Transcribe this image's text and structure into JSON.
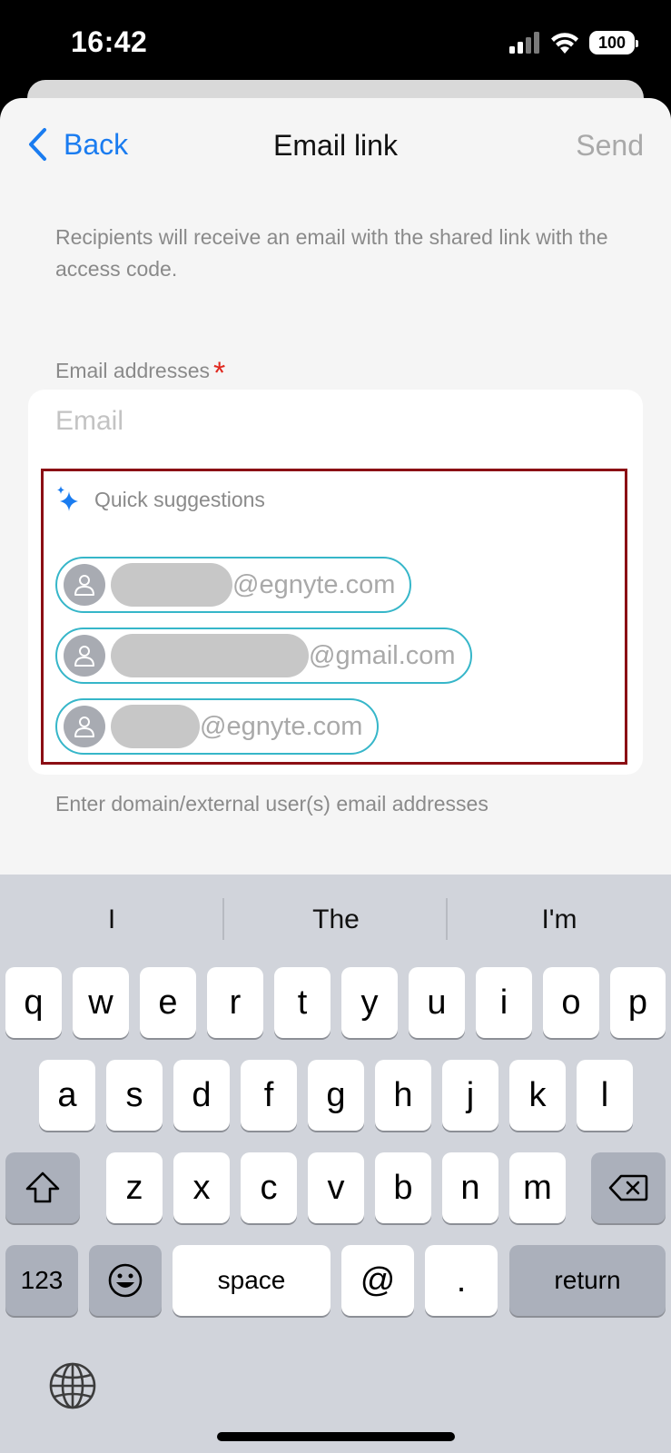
{
  "status_bar": {
    "time": "16:42",
    "battery": "100"
  },
  "nav": {
    "back_label": "Back",
    "title": "Email link",
    "send_label": "Send"
  },
  "description": "Recipients will receive an email with the shared link with the access code.",
  "email_field": {
    "label": "Email addresses",
    "required_mark": "*",
    "placeholder": "Email",
    "value": ""
  },
  "suggestions": {
    "title": "Quick suggestions",
    "items": [
      {
        "domain": "@egnyte.com"
      },
      {
        "domain": "@gmail.com"
      },
      {
        "domain": "@egnyte.com"
      }
    ]
  },
  "helper_text": "Enter domain/external user(s) email addresses",
  "keyboard": {
    "predictions": [
      "I",
      "The",
      "I'm"
    ],
    "row1": [
      "q",
      "w",
      "e",
      "r",
      "t",
      "y",
      "u",
      "i",
      "o",
      "p"
    ],
    "row2": [
      "a",
      "s",
      "d",
      "f",
      "g",
      "h",
      "j",
      "k",
      "l"
    ],
    "row3": [
      "z",
      "x",
      "c",
      "v",
      "b",
      "n",
      "m"
    ],
    "numbers_key": "123",
    "space_key": "space",
    "at_key": "@",
    "dot_key": ".",
    "return_key": "return"
  },
  "colors": {
    "accent": "#1a7cf0",
    "chip_border": "#36b6c9",
    "highlight_box": "#8b0f14",
    "required": "#e0281e"
  }
}
